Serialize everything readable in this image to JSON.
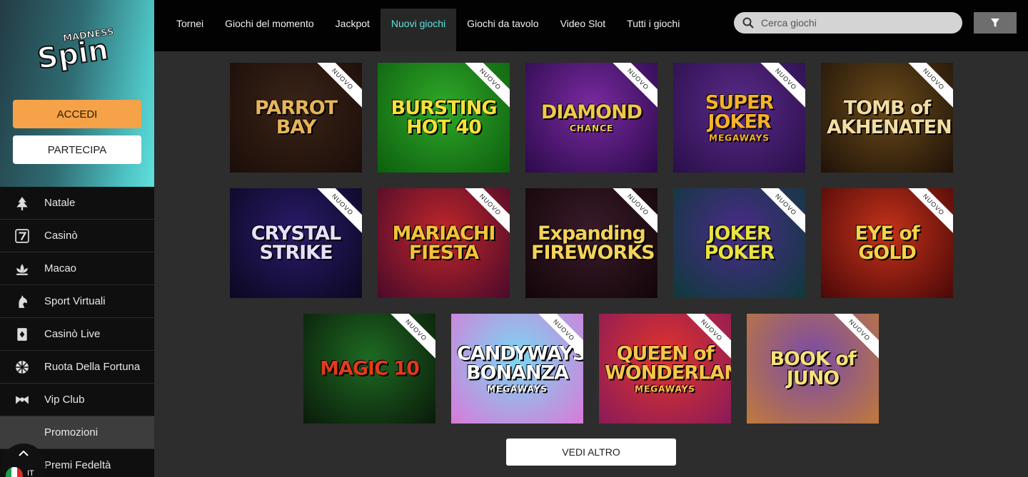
{
  "brand": {
    "logo_text_top": "MADNESS",
    "logo_text_main": "Spin"
  },
  "auth": {
    "login": "ACCEDI",
    "join": "PARTECIPA"
  },
  "sidebar": {
    "items": [
      {
        "label": "Natale",
        "icon": "christmas-tree-icon"
      },
      {
        "label": "Casinò",
        "icon": "seven-icon"
      },
      {
        "label": "Macao",
        "icon": "lotus-icon"
      },
      {
        "label": "Sport Virtuali",
        "icon": "horse-icon"
      },
      {
        "label": "Casinò Live",
        "icon": "card-icon"
      },
      {
        "label": "Ruota Della Fortuna",
        "icon": "wheel-icon"
      },
      {
        "label": "Vip Club",
        "icon": "bowtie-icon"
      },
      {
        "label": "Promozioni",
        "icon": ""
      },
      {
        "label": "Premi Fedeltà",
        "icon": ""
      }
    ],
    "language": "IT"
  },
  "tabs": [
    {
      "label": "Tornei",
      "active": false
    },
    {
      "label": "Giochi del momento",
      "active": false
    },
    {
      "label": "Jackpot",
      "active": false
    },
    {
      "label": "Nuovi giochi",
      "active": true
    },
    {
      "label": "Giochi da tavolo",
      "active": false
    },
    {
      "label": "Video Slot",
      "active": false
    },
    {
      "label": "Tutti i giochi",
      "active": false
    }
  ],
  "search": {
    "placeholder": "Cerca giochi"
  },
  "badge": "NUOVO",
  "games": [
    {
      "title": "PARROT BAY",
      "sub": "",
      "colors": [
        "#3a2418",
        "#1a0d08"
      ],
      "text": "#e7b45a"
    },
    {
      "title": "BURSTING HOT 40",
      "sub": "",
      "colors": [
        "#2fa82a",
        "#0d5e0d"
      ],
      "text": "#f4e13a"
    },
    {
      "title": "DIAMOND",
      "sub": "CHANCE",
      "colors": [
        "#7a2aa0",
        "#2a0a4a"
      ],
      "text": "#f1c94a"
    },
    {
      "title": "SUPER JOKER",
      "sub": "MEGAWAYS",
      "colors": [
        "#5a2a8a",
        "#2a0f4a"
      ],
      "text": "#f6b22a"
    },
    {
      "title": "TOMB of AKHENATEN",
      "sub": "",
      "colors": [
        "#6a4a1a",
        "#1e1208"
      ],
      "text": "#f3dca0"
    },
    {
      "title": "CRYSTAL STRIKE",
      "sub": "",
      "colors": [
        "#2a1a6a",
        "#0a0820"
      ],
      "text": "#e8e0ff"
    },
    {
      "title": "MARIACHI FIESTA",
      "sub": "",
      "colors": [
        "#c0262a",
        "#4a0a2a"
      ],
      "text": "#f3c23a"
    },
    {
      "title": "Expanding FIREWORKS",
      "sub": "",
      "colors": [
        "#3a1a2a",
        "#120608"
      ],
      "text": "#f5d25a"
    },
    {
      "title": "JOKER POKER",
      "sub": "",
      "colors": [
        "#4a2a8a",
        "#0e3a3a"
      ],
      "text": "#e9e240"
    },
    {
      "title": "EYE of GOLD",
      "sub": "",
      "colors": [
        "#c4321a",
        "#4a0808"
      ],
      "text": "#f7d24a"
    },
    {
      "title": "MAGIC 10",
      "sub": "",
      "colors": [
        "#1e6a22",
        "#0a1a0a"
      ],
      "text": "#e33a1a"
    },
    {
      "title": "CANDYWAYS BONANZA",
      "sub": "MEGAWAYS",
      "colors": [
        "#7ad6f2",
        "#d87ad8"
      ],
      "text": "#ffffff"
    },
    {
      "title": "QUEEN of WONDERLAND",
      "sub": "MEGAWAYS",
      "colors": [
        "#e0342a",
        "#8a1a5a"
      ],
      "text": "#f7c64a"
    },
    {
      "title": "BOOK of JUNO",
      "sub": "",
      "colors": [
        "#7a4aa8",
        "#c07a3a"
      ],
      "text": "#f7e07a"
    }
  ],
  "more_button": "VEDI ALTRO"
}
